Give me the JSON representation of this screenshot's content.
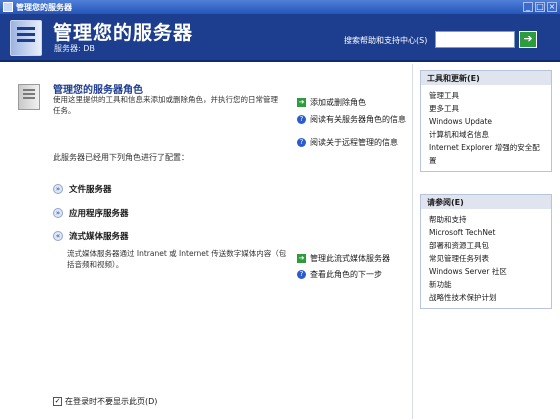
{
  "window": {
    "title": "管理您的服务器"
  },
  "banner": {
    "title": "管理您的服务器",
    "server": "服务器: DB",
    "search_label": "搜索帮助和支持中心(S)",
    "search_value": "",
    "go_label": "➔"
  },
  "roles": {
    "heading": "管理您的服务器角色",
    "description": "使用这里提供的工具和信息来添加或删除角色，并执行您的日常管理任务。",
    "add_remove": "添加或删除角色",
    "read_more_roles": "阅读有关服务器角色的信息",
    "read_remote": "阅读关于远程管理的信息",
    "configured_text": "此服务器已经用下列角色进行了配置：",
    "items": [
      {
        "name": "文件服务器",
        "expand": "»"
      },
      {
        "name": "应用程序服务器",
        "expand": "»"
      },
      {
        "name": "流式媒体服务器",
        "expand": "«"
      }
    ],
    "stream_desc": "流式媒体服务器通过 Intranet 或 Internet 传送数字媒体内容（包括音频和视频）。",
    "manage_stream": "管理此流式媒体服务器",
    "review_next": "查看此角色的下一步"
  },
  "hide_page": {
    "label": "在登录时不要显示此页(D)",
    "checked": true
  },
  "tools_panel": {
    "header": "工具和更新(E)",
    "links": [
      "管理工具",
      "更多工具",
      "Windows Update",
      "计算机和域名信息",
      "Internet Explorer 增强的安全配置"
    ]
  },
  "see_also_panel": {
    "header": "请参阅(E)",
    "links": [
      "帮助和支持",
      "Microsoft TechNet",
      "部署和资源工具包",
      "常见管理任务列表",
      "Windows Server 社区",
      "新功能",
      "战略性技术保护计划"
    ]
  },
  "colors": {
    "banner": "#1d3d8f",
    "accent_green": "#2e9c3c",
    "help_blue": "#2a5bd0"
  }
}
